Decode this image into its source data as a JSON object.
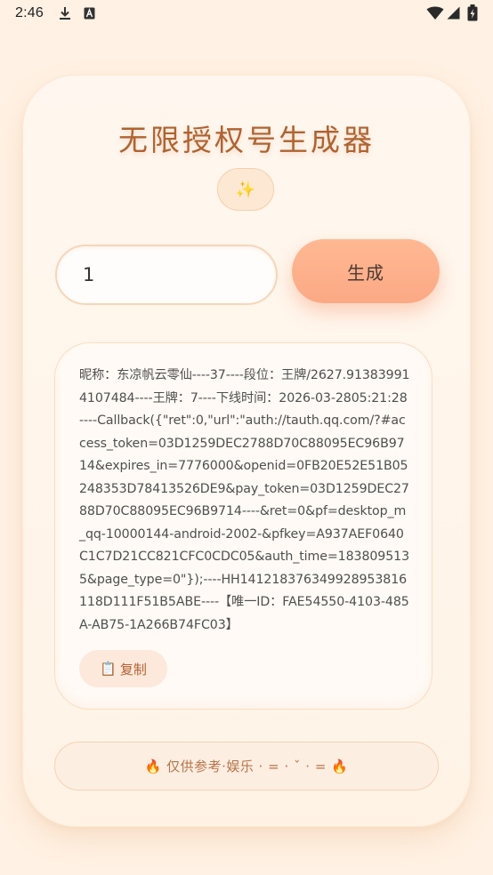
{
  "status_bar": {
    "time": "2:46",
    "icons": [
      "download-icon",
      "text-badge-icon",
      "wifi-icon",
      "signal-icon",
      "battery-icon"
    ]
  },
  "app": {
    "title": "无限授权号生成器",
    "sparkle_emoji": "✨",
    "count_input": {
      "value": "1",
      "placeholder": ""
    },
    "generate_label": "生成",
    "result_text": "昵称：东凉帆云零仙----37----段位：王牌/2627.913839914107484----王牌：7----下线时间：2026-03-2805:21:28----Callback({\"ret\":0,\"url\":\"auth://tauth.qq.com/?#access_token=03D1259DEC2788D70C88095EC96B9714&expires_in=7776000&openid=0FB20E52E51B05248353D78413526DE9&pay_token=03D1259DEC2788D70C88095EC96B9714----&ret=0&pf=desktop_m_qq-10000144-android-2002-&pfkey=A937AEF0640C1C7D21CC821CFC0CDC05&auth_time=1838095135&page_type=0\"});----HH141218376349928953816118D111F51B5ABE----【唯一ID：FAE54550-4103-485A-AB75-1A266B74FC03】",
    "copy_emoji": "📋",
    "copy_label": "复制",
    "footer_text": "🔥 仅供参考·娱乐 · = · ˇ · = 🔥"
  },
  "colors": {
    "background": "#fff1e3",
    "title": "#b0632f",
    "accent_button": "#fba985"
  }
}
